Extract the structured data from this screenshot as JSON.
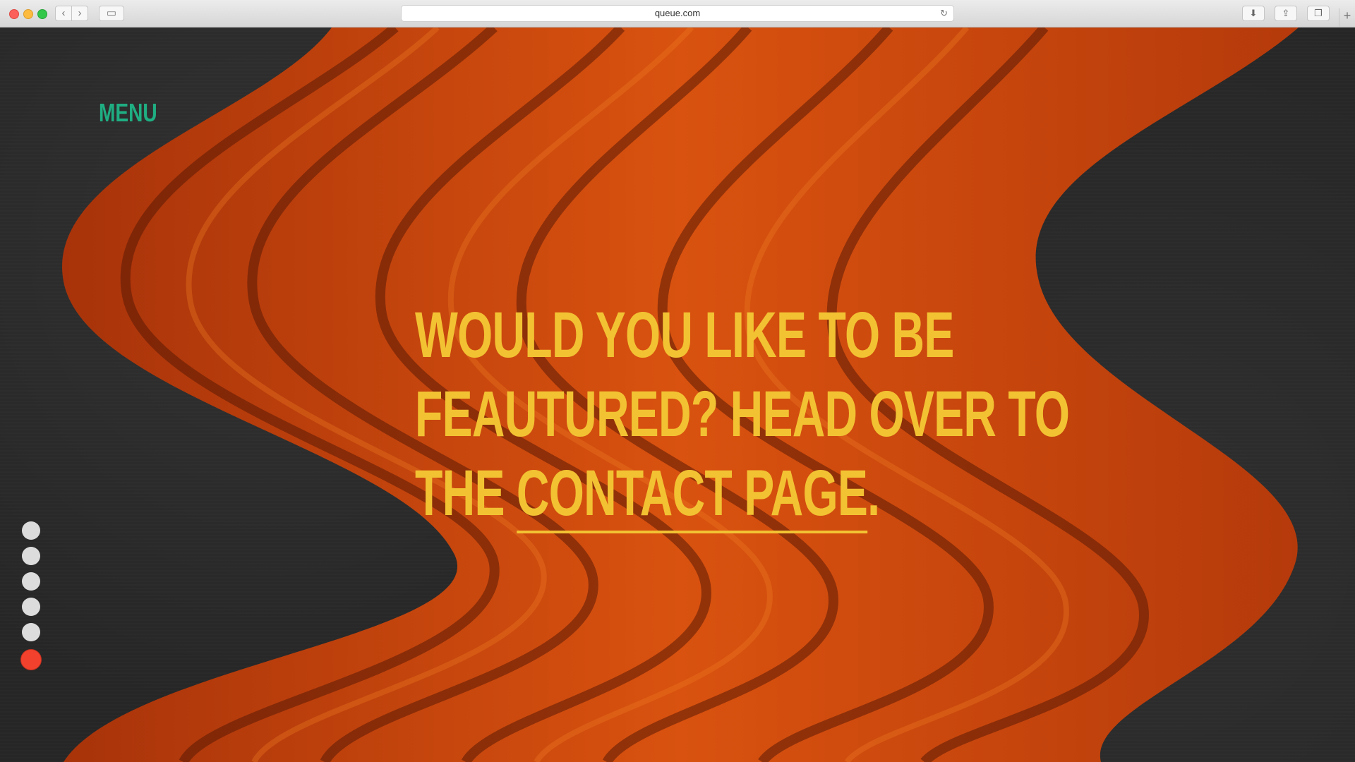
{
  "browser": {
    "url": "queue.com",
    "icons": {
      "back": "chevron-left-icon",
      "forward": "chevron-right-icon",
      "sidebar": "sidebar-icon",
      "reload": "reload-icon",
      "download": "download-icon",
      "share": "share-icon",
      "tabs": "tabs-icon",
      "new_tab": "plus-icon"
    }
  },
  "page": {
    "menu_label": "MENU",
    "headline": {
      "line1": "WOULD YOU LIKE TO BE",
      "line2": "FEAUTURED? HEAD OVER TO",
      "line3_prefix": "THE ",
      "link_text": "CONTACT PAGE",
      "line3_suffix": "."
    },
    "pagination": {
      "total": 6,
      "active_index": 6
    },
    "colors": {
      "menu": "#1fae82",
      "headline": "#f2c233",
      "active_dot": "#f2422d",
      "inactive_dot": "#dcdcdc",
      "background": "#262626",
      "wave": "#c9440e"
    }
  }
}
